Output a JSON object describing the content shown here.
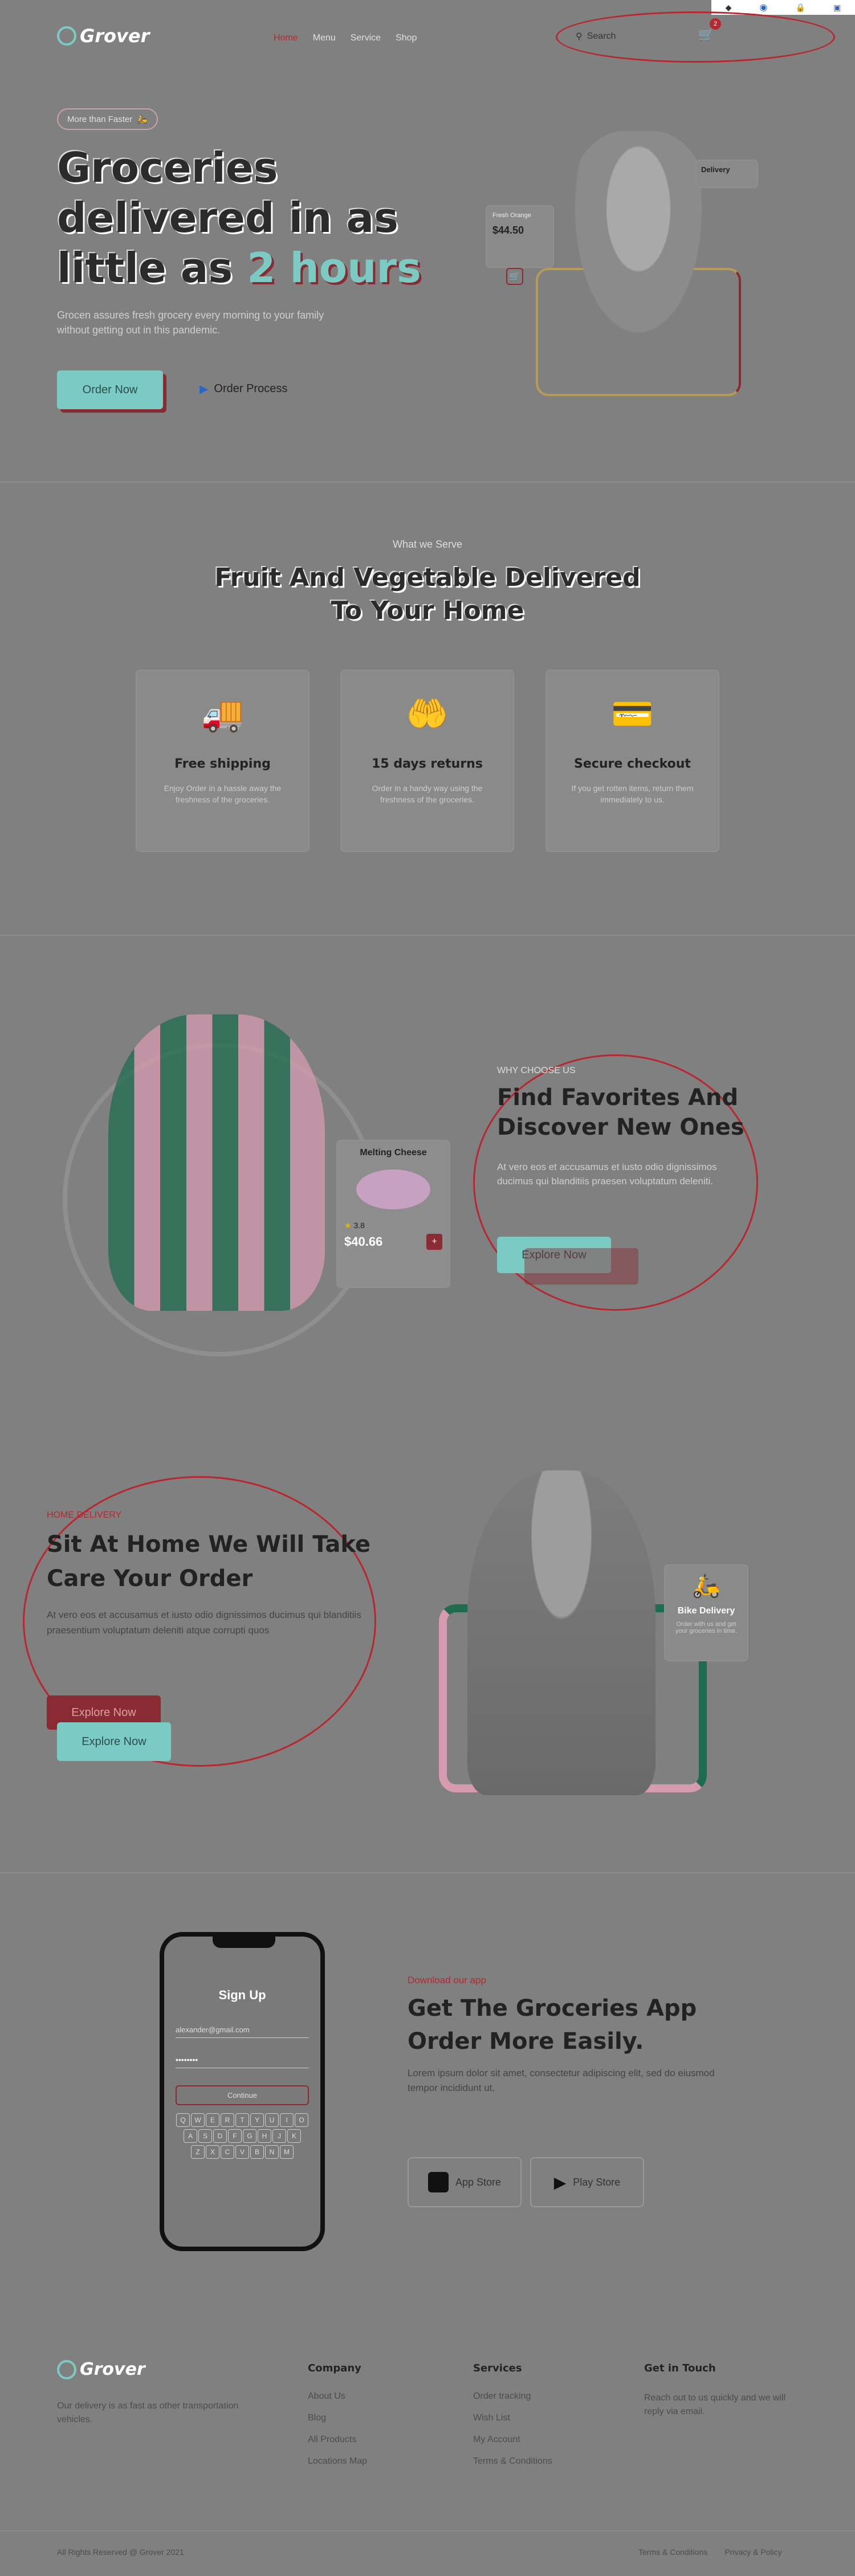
{
  "browser_icons": [
    "diamond-icon",
    "eye-icon",
    "lock-icon",
    "extension-icon"
  ],
  "header": {
    "logo": "Grover",
    "nav": [
      "Home",
      "Menu",
      "Service",
      "Shop"
    ],
    "search_label": "Search",
    "cart_count": "2"
  },
  "hero": {
    "badge": "More than Faster",
    "title_line1": "Groceries",
    "title_line2": "delivered in as",
    "title_line3_a": "little as",
    "title_line3_b": "2 hours",
    "description": "Grocen assures fresh grocery every morning to your family without getting out in this pandemic.",
    "order_button": "Order Now",
    "process_link": "Order Process",
    "card_title": "Fresh Orange",
    "card_price": "$44.50",
    "delivery_label": "Delivery"
  },
  "services": {
    "eyebrow": "What we Serve",
    "title_line1": "Fruit And Vegetable Delivered",
    "title_line2": "To Your Home",
    "items": [
      {
        "title": "Free shipping",
        "desc": "Enjoy Order in a hassle away the freshness of the groceries."
      },
      {
        "title": "15 days returns",
        "desc": "Order in a handy way using the freshness of the groceries."
      },
      {
        "title": "Secure checkout",
        "desc": "If you get rotten items, return them immediately to us."
      }
    ]
  },
  "choose": {
    "eyebrow": "WHY CHOOSE US",
    "title_line1": "Find Favorites And",
    "title_line2": "Discover New Ones",
    "desc": "At vero eos et accusamus et iusto odio dignissimos ducimus qui blanditiis praesen voluptatum deleniti.",
    "button": "Explore Now",
    "product_name": "Melting Cheese",
    "product_rating": "3.8",
    "product_price": "$40.66"
  },
  "home_delivery": {
    "eyebrow": "HOME DELIVERY",
    "title_line1": "Sit At Home We Will Take",
    "title_line2": "Care Your Order",
    "desc": "At vero eos et accusamus et iusto odio dignissimos ducimus qui blanditiis praesentium voluptatum deleniti atque corrupti quos",
    "button_red": "Explore Now",
    "button_teal": "Explore Now",
    "card_title": "Bike Delivery",
    "card_desc": "Order with us and get your groceries in time."
  },
  "app": {
    "eyebrow": "Download our app",
    "title_line1": "Get The Groceries App",
    "title_line2": "Order More Easily.",
    "desc": "Lorem ipsum dolor sit amet, consectetur adipiscing elit, sed do eiusmod tempor incididunt ut.",
    "app_store": "App Store",
    "play_store": "Play Store",
    "phone_title": "Sign Up",
    "phone_email": "alexander@gmail.com",
    "phone_button": "Continue",
    "keyboard_rows": [
      [
        "Q",
        "W",
        "E",
        "R",
        "T",
        "Y",
        "U",
        "I",
        "O",
        "P"
      ],
      [
        "A",
        "S",
        "D",
        "F",
        "G",
        "H",
        "J",
        "K",
        "L"
      ],
      [
        "Z",
        "X",
        "C",
        "V",
        "B",
        "N",
        "M"
      ]
    ]
  },
  "footer": {
    "logo": "Grover",
    "about": "Our delivery is as fast as other transportation vehicles.",
    "columns": [
      {
        "title": "Company",
        "links": [
          "About Us",
          "Blog",
          "All Products",
          "Locations Map"
        ]
      },
      {
        "title": "Services",
        "links": [
          "Order tracking",
          "Wish List",
          "My Account",
          "Terms & Conditions"
        ]
      },
      {
        "title": "Get in Touch",
        "links": [
          "Reach out to us quickly and we will reply via email."
        ]
      }
    ],
    "copyright": "All Rights Reserved @ Grover 2021",
    "bottom_links": [
      "Terms & Conditions",
      "Privacy & Policy"
    ]
  },
  "colors": {
    "teal": "#7bcac4",
    "red": "#8a2b33",
    "accent_red": "#b8272f",
    "bg": "#808080"
  }
}
